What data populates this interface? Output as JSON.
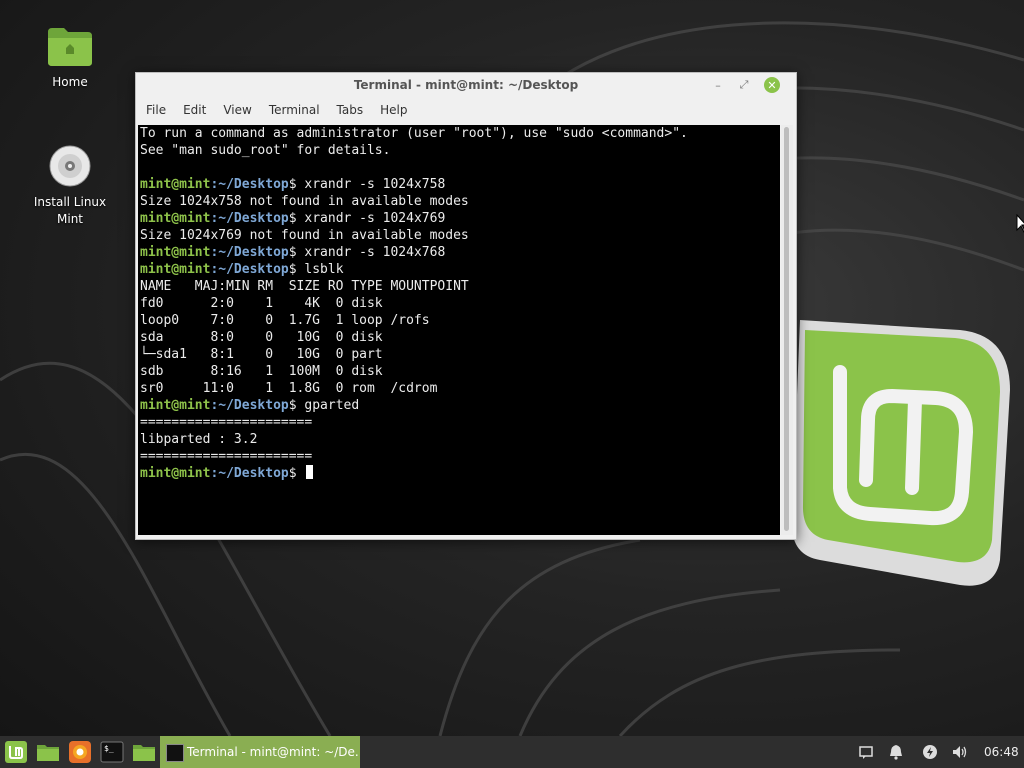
{
  "desktop": {
    "icons": [
      {
        "label": "Home",
        "icon": "folder-home-icon"
      },
      {
        "label": "Install Linux Mint",
        "icon": "disc-icon"
      }
    ]
  },
  "terminal": {
    "title": "Terminal - mint@mint: ~/Desktop",
    "menu": [
      "File",
      "Edit",
      "View",
      "Terminal",
      "Tabs",
      "Help"
    ],
    "prompt_user": "mint@mint",
    "prompt_path": ":~/Desktop",
    "prompt_end": "$ ",
    "lines": [
      {
        "kind": "out",
        "text": "To run a command as administrator (user \"root\"), use \"sudo <command>\"."
      },
      {
        "kind": "out",
        "text": "See \"man sudo_root\" for details."
      },
      {
        "kind": "out",
        "text": ""
      },
      {
        "kind": "cmd",
        "text": "xrandr -s 1024x758"
      },
      {
        "kind": "out",
        "text": "Size 1024x758 not found in available modes"
      },
      {
        "kind": "cmd",
        "text": "xrandr -s 1024x769"
      },
      {
        "kind": "out",
        "text": "Size 1024x769 not found in available modes"
      },
      {
        "kind": "cmd",
        "text": "xrandr -s 1024x768"
      },
      {
        "kind": "cmd",
        "text": "lsblk"
      },
      {
        "kind": "out",
        "text": "NAME   MAJ:MIN RM  SIZE RO TYPE MOUNTPOINT"
      },
      {
        "kind": "out",
        "text": "fd0      2:0    1    4K  0 disk"
      },
      {
        "kind": "out",
        "text": "loop0    7:0    0  1.7G  1 loop /rofs"
      },
      {
        "kind": "out",
        "text": "sda      8:0    0   10G  0 disk"
      },
      {
        "kind": "out",
        "text": "└─sda1   8:1    0   10G  0 part"
      },
      {
        "kind": "out",
        "text": "sdb      8:16   1  100M  0 disk"
      },
      {
        "kind": "out",
        "text": "sr0     11:0    1  1.8G  0 rom  /cdrom"
      },
      {
        "kind": "cmd",
        "text": "gparted"
      },
      {
        "kind": "out",
        "text": "======================"
      },
      {
        "kind": "out",
        "text": "libparted : 3.2"
      },
      {
        "kind": "out",
        "text": "======================"
      },
      {
        "kind": "prompt",
        "text": ""
      }
    ]
  },
  "taskbar": {
    "window_label": "Terminal - mint@mint: ~/De...",
    "launchers": [
      "mint-menu-icon",
      "files-icon",
      "firefox-icon",
      "terminal-icon",
      "files-icon"
    ],
    "tray": [
      "notes-icon",
      "notification-bell-icon",
      "power-icon",
      "volume-icon"
    ],
    "clock": "06:48"
  },
  "colors": {
    "mint_green": "#8bc34a",
    "taskbar_active": "#8aae52",
    "prompt_user": "#8ec24a",
    "prompt_path": "#7fa8d6"
  }
}
